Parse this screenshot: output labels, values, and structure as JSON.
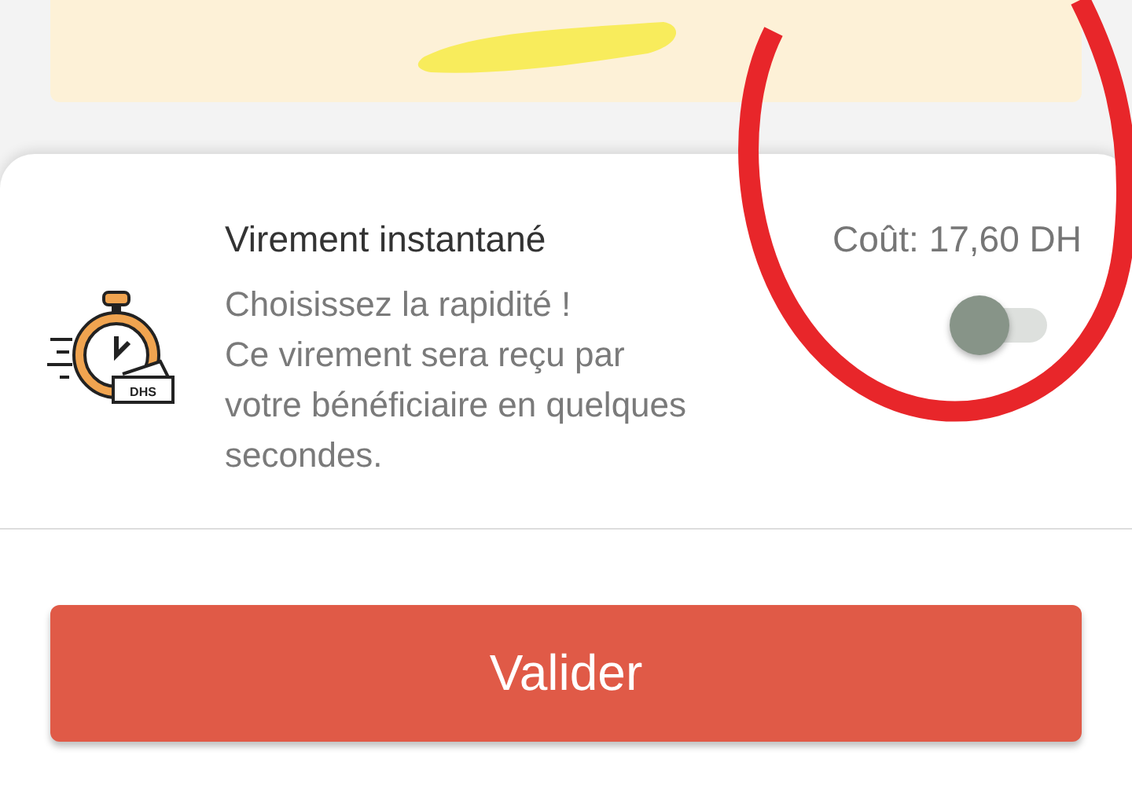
{
  "option": {
    "title": "Virement instantané",
    "cost": "Coût: 17,60 DH",
    "icon_label": "DHS",
    "description_lines": [
      "Choisissez la rapidité !",
      "Ce virement sera reçu par",
      "votre bénéficiaire en quelques",
      "secondes."
    ],
    "toggle": {
      "checked": false
    }
  },
  "primary_button": {
    "label": "Valider"
  }
}
